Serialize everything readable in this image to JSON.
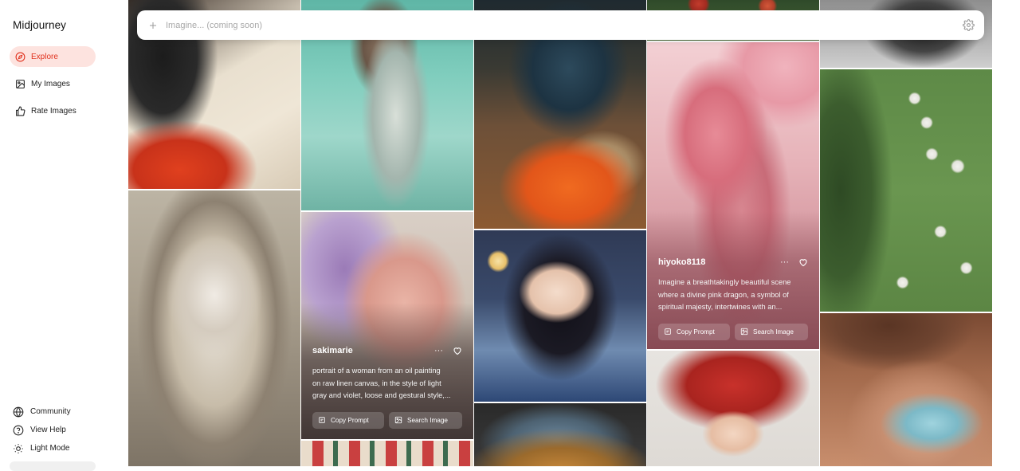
{
  "app": {
    "brand": "Midjourney"
  },
  "nav": {
    "items": [
      {
        "label": "Explore",
        "icon": "compass-icon",
        "active": true
      },
      {
        "label": "My Images",
        "icon": "image-icon",
        "active": false
      },
      {
        "label": "Rate Images",
        "icon": "thumbs-up-icon",
        "active": false
      }
    ],
    "bottom": [
      {
        "label": "Community",
        "icon": "globe-icon"
      },
      {
        "label": "View Help",
        "icon": "help-circle-icon"
      },
      {
        "label": "Light Mode",
        "icon": "sun-icon"
      }
    ]
  },
  "search": {
    "placeholder": "Imagine... (coming soon)",
    "value": ""
  },
  "colors": {
    "accent": "#e0311d",
    "accent_bg": "#fde3df"
  },
  "cards": [
    {
      "id": "card-sakimarie",
      "username": "sakimarie",
      "prompt_lines": [
        "portrait of a woman from an oil painting",
        "on raw linen canvas, in the style of light",
        "gray and violet, loose and gestural style,..."
      ],
      "copy_label": "Copy Prompt",
      "search_label": "Search Image"
    },
    {
      "id": "card-hiyoko",
      "username": "hiyoko8118",
      "prompt_lines": [
        "Imagine a breathtakingly beautiful scene",
        "where a divine pink dragon, a symbol of",
        "spiritual majesty, intertwines with an..."
      ],
      "copy_label": "Copy Prompt",
      "search_label": "Search Image"
    }
  ]
}
